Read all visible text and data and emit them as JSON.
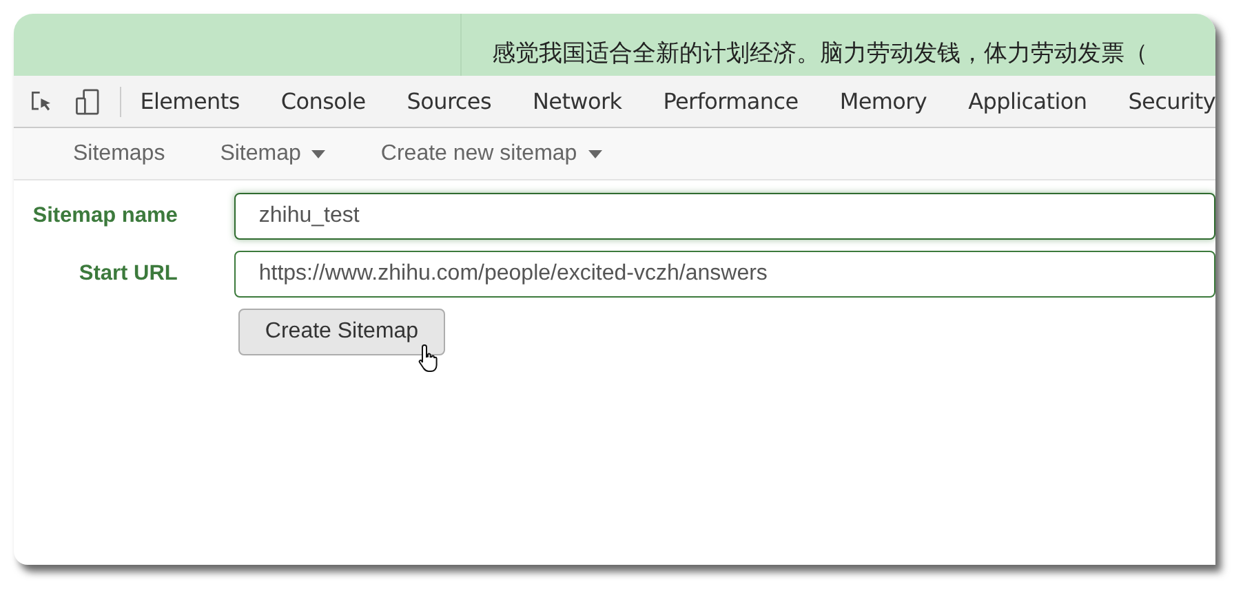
{
  "page_behind": {
    "text": "感觉我国适合全新的计划经济。脑力劳动发钱，体力劳动发票（"
  },
  "devtools_tabs": [
    {
      "label": "Elements"
    },
    {
      "label": "Console"
    },
    {
      "label": "Sources"
    },
    {
      "label": "Network"
    },
    {
      "label": "Performance"
    },
    {
      "label": "Memory"
    },
    {
      "label": "Application"
    },
    {
      "label": "Security"
    }
  ],
  "nav": [
    {
      "label": "Sitemaps",
      "has_menu": false
    },
    {
      "label": "Sitemap",
      "has_menu": true
    },
    {
      "label": "Create new sitemap",
      "has_menu": true
    }
  ],
  "form": {
    "fields": [
      {
        "label": "Sitemap name",
        "value": "zhihu_test",
        "focused": true
      },
      {
        "label": "Start URL",
        "value": "https://www.zhihu.com/people/excited-vczh/answers",
        "focused": false
      }
    ],
    "button": "Create Sitemap"
  }
}
